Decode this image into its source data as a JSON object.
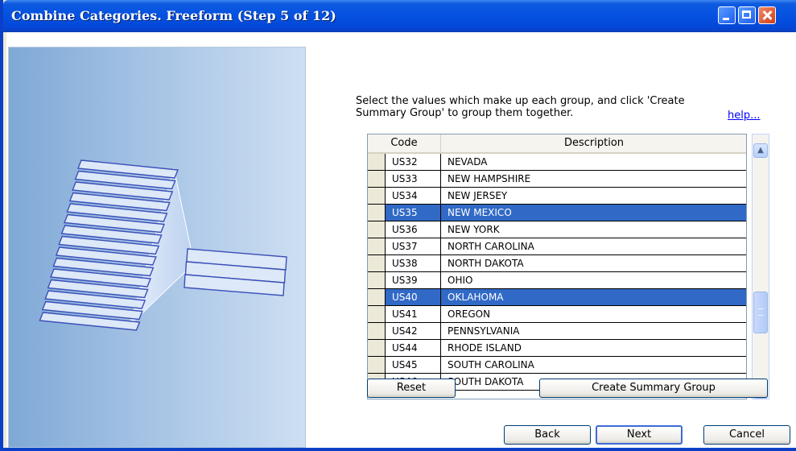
{
  "window": {
    "title": "Combine Categories.  Freeform (Step 5 of 12)",
    "controls": {
      "minimize": "minimize-icon",
      "maximize": "maximize-icon",
      "close": "close-icon"
    }
  },
  "instructions": {
    "text_line1": "Select the values which make up each group, and click 'Create",
    "text_line2": "Summary Group' to group them together.",
    "help_link": "help..."
  },
  "grid": {
    "columns": [
      "Code",
      "Description"
    ],
    "rows": [
      {
        "code": "US32",
        "description": "NEVADA",
        "selected": false
      },
      {
        "code": "US33",
        "description": "NEW HAMPSHIRE",
        "selected": false
      },
      {
        "code": "US34",
        "description": "NEW JERSEY",
        "selected": false
      },
      {
        "code": "US35",
        "description": "NEW MEXICO",
        "selected": true
      },
      {
        "code": "US36",
        "description": "NEW YORK",
        "selected": false
      },
      {
        "code": "US37",
        "description": "NORTH CAROLINA",
        "selected": false
      },
      {
        "code": "US38",
        "description": "NORTH DAKOTA",
        "selected": false
      },
      {
        "code": "US39",
        "description": "OHIO",
        "selected": false
      },
      {
        "code": "US40",
        "description": "OKLAHOMA",
        "selected": true
      },
      {
        "code": "US41",
        "description": "OREGON",
        "selected": false
      },
      {
        "code": "US42",
        "description": "PENNSYLVANIA",
        "selected": false
      },
      {
        "code": "US44",
        "description": "RHODE ISLAND",
        "selected": false
      },
      {
        "code": "US45",
        "description": "SOUTH CAROLINA",
        "selected": false
      },
      {
        "code": "US46",
        "description": "SOUTH DAKOTA",
        "selected": false
      }
    ]
  },
  "buttons": {
    "reset": "Reset",
    "create_summary_group": "Create Summary Group",
    "back": "Back",
    "next": "Next",
    "cancel": "Cancel"
  },
  "colors": {
    "titlebar": "#0551e0",
    "selection": "#3169c6",
    "link": "#0000ff"
  }
}
